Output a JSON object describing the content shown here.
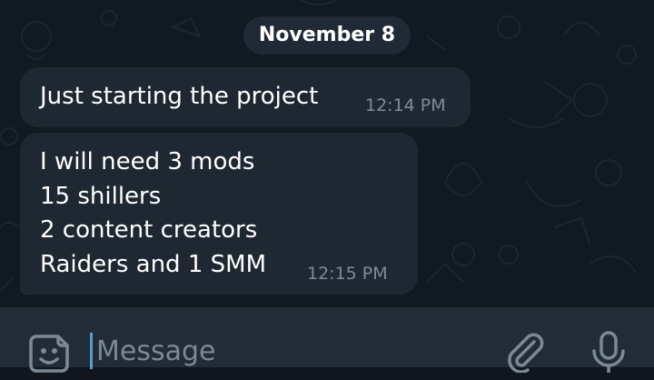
{
  "chat": {
    "date_separator": "November 8",
    "messages": [
      {
        "text": "Just starting the project",
        "time": "12:14 PM"
      },
      {
        "text": "I will need 3 mods\n15 shillers\n2 content creators\nRaiders and 1 SMM",
        "time": "12:15 PM"
      }
    ]
  },
  "composer": {
    "placeholder": "Message",
    "value": "",
    "icons": {
      "emoji": "sticker-smile-icon",
      "attach": "paperclip-icon",
      "voice": "microphone-icon"
    }
  },
  "colors": {
    "chat_background": "#111a22",
    "bubble": "#1e2833",
    "composer": "#222c37",
    "timestamp": "#7c8b9a",
    "cursor": "#5b9bd5"
  }
}
